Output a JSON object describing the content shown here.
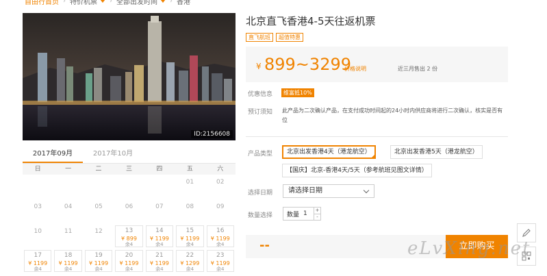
{
  "breadcrumb": {
    "home": "自由行首页",
    "flight_deals": "特价机票",
    "departure_time": "全部出发时间",
    "destination": "香港"
  },
  "photo": {
    "id_label": "ID:2156608"
  },
  "calendar": {
    "months": [
      "2017年09月",
      "2017年10月"
    ],
    "active_month_index": 0,
    "weekdays": [
      "日",
      "一",
      "二",
      "三",
      "四",
      "五",
      "六"
    ],
    "rows": [
      [
        {
          "d": ""
        },
        {
          "d": ""
        },
        {
          "d": ""
        },
        {
          "d": ""
        },
        {
          "d": ""
        },
        {
          "d": "01"
        },
        {
          "d": "02"
        }
      ],
      [
        {
          "d": "03"
        },
        {
          "d": "04"
        },
        {
          "d": "05"
        },
        {
          "d": "06"
        },
        {
          "d": "07"
        },
        {
          "d": "08"
        },
        {
          "d": "09"
        }
      ],
      [
        {
          "d": "10"
        },
        {
          "d": "11"
        },
        {
          "d": "12"
        },
        {
          "d": "13",
          "p": "¥ 899",
          "s": "余4"
        },
        {
          "d": "14",
          "p": "¥ 1199",
          "s": "余4"
        },
        {
          "d": "15",
          "p": "¥ 1199",
          "s": "余4"
        },
        {
          "d": "16",
          "p": "¥ 1199",
          "s": "余4"
        }
      ],
      [
        {
          "d": "17",
          "p": "¥ 1199",
          "s": "余4"
        },
        {
          "d": "18",
          "p": "¥ 1199",
          "s": "余4"
        },
        {
          "d": "19",
          "p": "¥ 1199",
          "s": "余4"
        },
        {
          "d": "20",
          "p": "¥ 1199",
          "s": "余4"
        },
        {
          "d": "21",
          "p": "¥ 1199",
          "s": "余4"
        },
        {
          "d": "22",
          "p": "¥ 1299",
          "s": "余4"
        },
        {
          "d": "23",
          "p": "¥ 1199",
          "s": "余4"
        }
      ]
    ]
  },
  "product": {
    "title": "北京直飞香港4-5天往返机票",
    "tags": [
      "直飞航班",
      "超值特惠"
    ],
    "price_symbol": "¥",
    "price_range": "899~3299",
    "price_explain": "价格说明",
    "sold_recent": "近三月售出 2 份",
    "promo_label": "优惠信息",
    "promo_badge": "维富抵10%",
    "notice_label": "预订须知",
    "notice_text": "此产品为二次确认产品，在支付成功时间起的24小时内供应商将进行二次确认，核实是否有位",
    "type_label": "产品类型",
    "options": [
      "北京出发香港4天（港龙航空）",
      "北京出发香港5天（港龙航空）",
      "【国庆】北京-香港4天/5天（参考航班见图文详情）"
    ],
    "date_label": "选择日期",
    "date_placeholder": "请选择日期",
    "qty_label": "数量选择",
    "qty_inner_label": "数量",
    "qty_value": "1",
    "qty_plus": "+",
    "qty_minus": "-",
    "total_placeholder": "--",
    "buy_label": "立即购买"
  },
  "watermark": "eLvXing.net",
  "colors": {
    "accent": "#f08300",
    "panel": "#f6f6f6"
  }
}
